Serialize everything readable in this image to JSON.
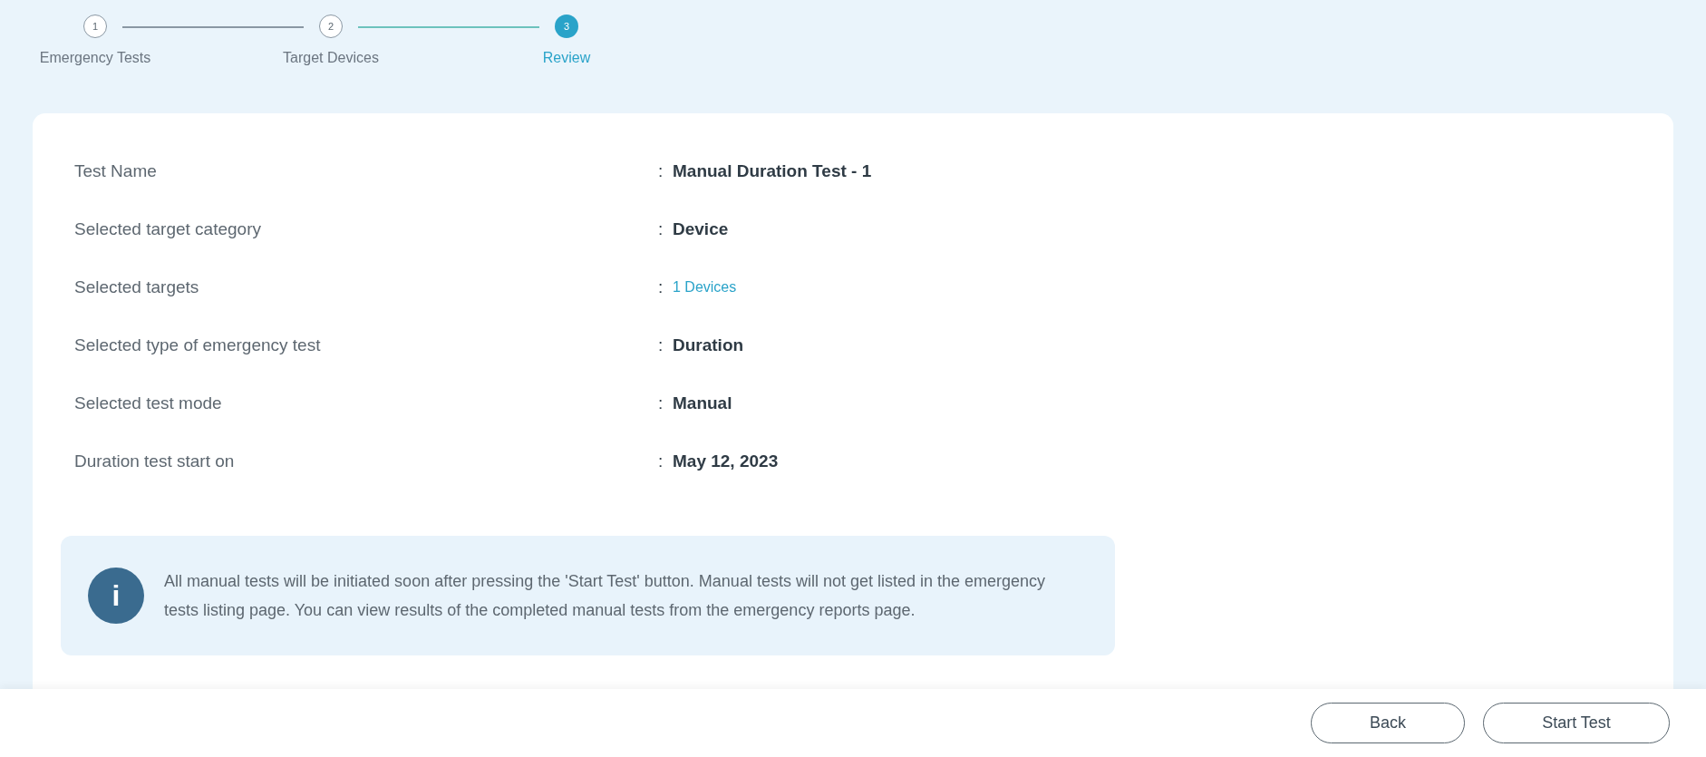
{
  "stepper": [
    {
      "number": "1",
      "label": "Emergency Tests",
      "selected": false
    },
    {
      "number": "2",
      "label": "Target Devices",
      "selected": false
    },
    {
      "number": "3",
      "label": "Review",
      "selected": true
    }
  ],
  "review": [
    {
      "label": "Test Name",
      "separator": ":",
      "value": "Manual Duration Test - 1",
      "kind": "text"
    },
    {
      "label": "Selected target category",
      "separator": ":",
      "value": "Device",
      "kind": "text"
    },
    {
      "label": "Selected targets",
      "separator": ":",
      "value": "1 Devices",
      "kind": "link"
    },
    {
      "label": "Selected type of emergency test",
      "separator": ":",
      "value": "Duration",
      "kind": "text"
    },
    {
      "label": "Selected test mode",
      "separator": ":",
      "value": "Manual",
      "kind": "text"
    },
    {
      "label": "Duration test start on",
      "separator": ":",
      "value": "May 12, 2023",
      "kind": "text"
    }
  ],
  "info": {
    "icon_text": "i",
    "message": "All manual tests will be initiated soon after pressing the 'Start Test' button. Manual tests will not get listed in the emergency tests listing page. You can view results of the completed manual tests from the emergency reports page."
  },
  "buttons": [
    "Back",
    "Start Test"
  ]
}
